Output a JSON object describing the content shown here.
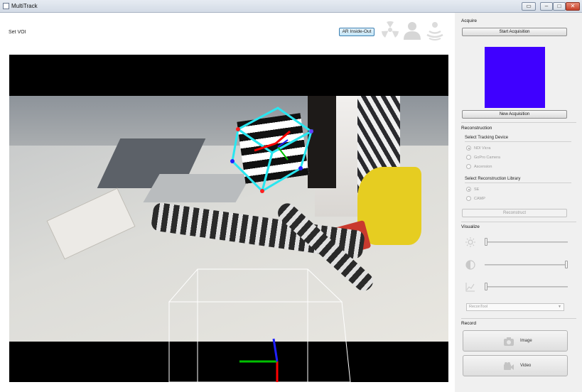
{
  "window": {
    "title": "MultiTrack"
  },
  "toolbar": {
    "set_voi_label": "Set VOI",
    "ar_mode_label": "AR Inside-Out",
    "mode_icons": [
      "radiation-icon",
      "person-icon",
      "signal-icon"
    ]
  },
  "acquire": {
    "title": "Acquire",
    "start_label": "Start Acquisition",
    "new_label": "New Acquisition",
    "preview_color": "#3f00ff"
  },
  "reconstruction": {
    "title": "Reconstruction",
    "tracking_title": "Select Tracking Device",
    "tracking_options": [
      "NDI Vicra",
      "GoPro Camera",
      "Ascension"
    ],
    "library_title": "Select Reconstruction Library",
    "library_options": [
      "SE",
      "CAMP"
    ],
    "reconstruct_label": "Reconstruct"
  },
  "visualize": {
    "title": "Visualize",
    "sliders": [
      {
        "icon": "brightness-icon",
        "value": 0.0
      },
      {
        "icon": "contrast-icon",
        "value": 1.0
      },
      {
        "icon": "chart-icon",
        "value": 0.0
      }
    ],
    "tool_select": "ReconTool"
  },
  "record": {
    "title": "Record",
    "image_label": "Image",
    "video_label": "Video"
  },
  "colors": {
    "overlay_cyan": "#29e6f0",
    "axis_red": "#ff0000",
    "axis_green": "#00c000",
    "axis_blue": "#2020ff"
  }
}
